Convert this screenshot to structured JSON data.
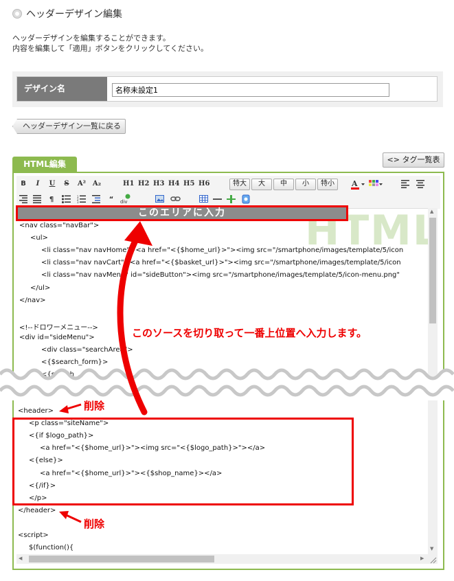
{
  "page": {
    "title": "ヘッダーデザイン編集",
    "description_lines": [
      "ヘッダーデザインを編集することができます。",
      "内容を編集して「適用」ボタンをクリックしてください。"
    ]
  },
  "form": {
    "label": "デザイン名",
    "value": "名称未設定1"
  },
  "buttons": {
    "back": "ヘッダーデザイン一覧に戻る",
    "tags": "<> タグ一覧表"
  },
  "tab": {
    "label": "HTML編集"
  },
  "toolbar": {
    "row1_text": [
      "B",
      "I",
      "U",
      "S",
      "A²",
      "A₂",
      "H1",
      "H2",
      "H3",
      "H4",
      "H5",
      "H6"
    ],
    "size_buttons": [
      "特大",
      "大",
      "中",
      "小",
      "特小"
    ]
  },
  "watermark": "HTML",
  "code": [
    {
      "indent": 0,
      "text": "<nav class=\"navBar\">"
    },
    {
      "indent": 1,
      "text": "<ul>"
    },
    {
      "indent": 2,
      "text": "<li class=\"nav navHome\"><a href=\"<{$home_url}>\"><img src=\"/smartphone/images/template/5/icon"
    },
    {
      "indent": 2,
      "text": "<li class=\"nav navCart\"><a href=\"<{$basket_url}>\"><img src=\"/smartphone/images/template/5/icon"
    },
    {
      "indent": 2,
      "text": "<li class=\"nav navMenu\" id=\"sideButton\"><img src=\"/smartphone/images/template/5/icon-menu.png\""
    },
    {
      "indent": 1,
      "text": "</ul>"
    },
    {
      "indent": 0,
      "text": "</nav>"
    },
    {
      "indent": 0,
      "text": ""
    },
    {
      "indent": 0,
      "text": "<!--ドロワーメニュー-->"
    },
    {
      "indent": 0,
      "text": "<div id=\"sideMenu\">"
    },
    {
      "indent": 2,
      "text": "<div class=\"searchArea\">"
    },
    {
      "indent": 2,
      "text": " <{$search_form}>"
    },
    {
      "indent": 2,
      "text": "         <{search_...}>"
    }
  ],
  "code2": [
    {
      "indent": 0,
      "text": "<header>"
    },
    {
      "indent": 1,
      "text": "<p class=\"siteName\">"
    },
    {
      "indent": 1,
      "text": "<{if $logo_path}>"
    },
    {
      "indent": 2,
      "text": "<a href=\"<{$home_url}>\"><img  src=\"<{$logo_path}>\"></a>"
    },
    {
      "indent": 1,
      "text": "<{else}>"
    },
    {
      "indent": 2,
      "text": "<a href=\"<{$home_url}>\"><{$shop_name}></a>"
    },
    {
      "indent": 1,
      "text": "<{/if}>"
    },
    {
      "indent": 1,
      "text": "</p>"
    },
    {
      "indent": 0,
      "text": "</header>"
    },
    {
      "indent": 0,
      "text": ""
    },
    {
      "indent": 0,
      "text": "<script>"
    },
    {
      "indent": 1,
      "text": "$(function(){"
    }
  ],
  "annotations": {
    "banner": "このエリアに入力",
    "instruction": "このソースを切り取って一番上位置へ入力します。",
    "delete": "削除"
  },
  "colors": {
    "accent_green": "#8dba4f",
    "annotation_red": "#e00000",
    "label_gray": "#7a7a7a"
  }
}
